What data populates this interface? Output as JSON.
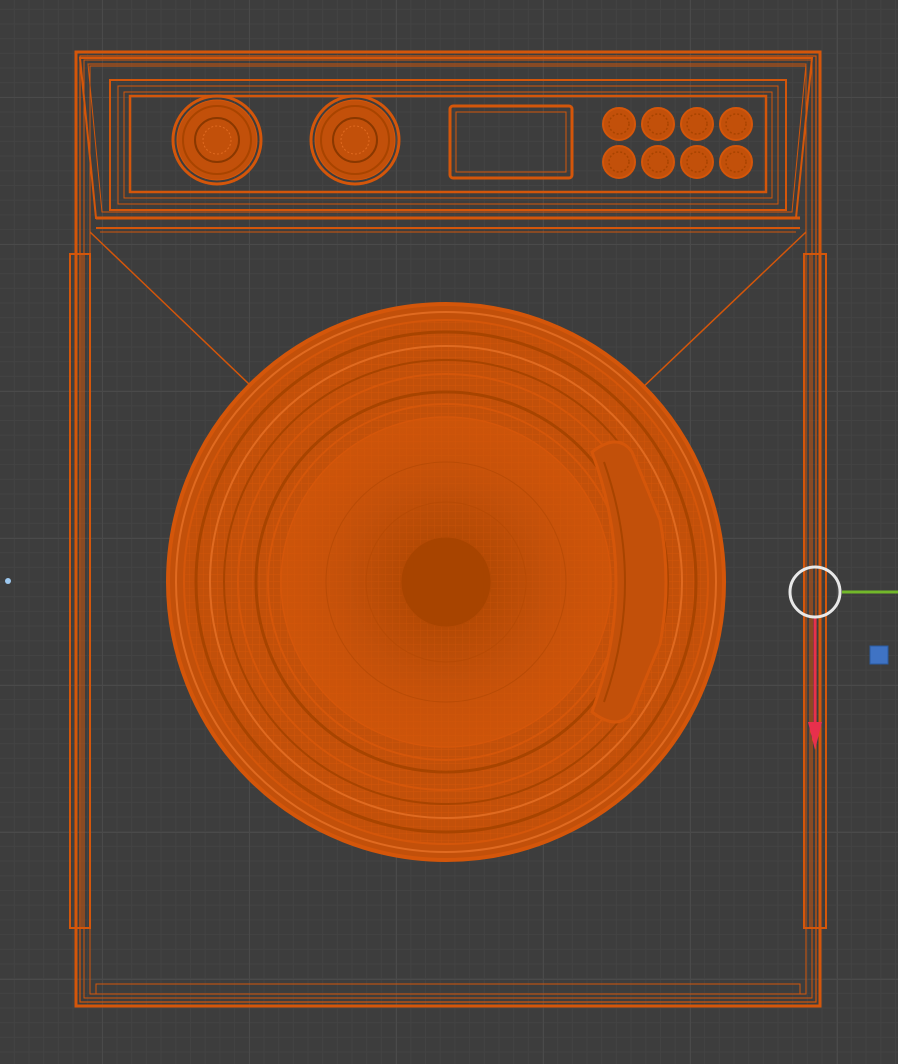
{
  "viewport": {
    "view": "front-orthographic",
    "shading": "wireframe",
    "background_color": "#3d3d3d",
    "grid_color": "#4a4a4a"
  },
  "selected_object": {
    "name": "washing-machine",
    "selection_color": "#d4560a",
    "selection_dark": "#a84400"
  },
  "gizmo": {
    "x_axis_color": "#72b82a",
    "z_axis_color": "#e8304c",
    "y_axis_color": "#3f73c4"
  },
  "icons": {
    "cursor_3d": "3d-cursor-icon",
    "origin_dot": "origin-point-icon"
  }
}
